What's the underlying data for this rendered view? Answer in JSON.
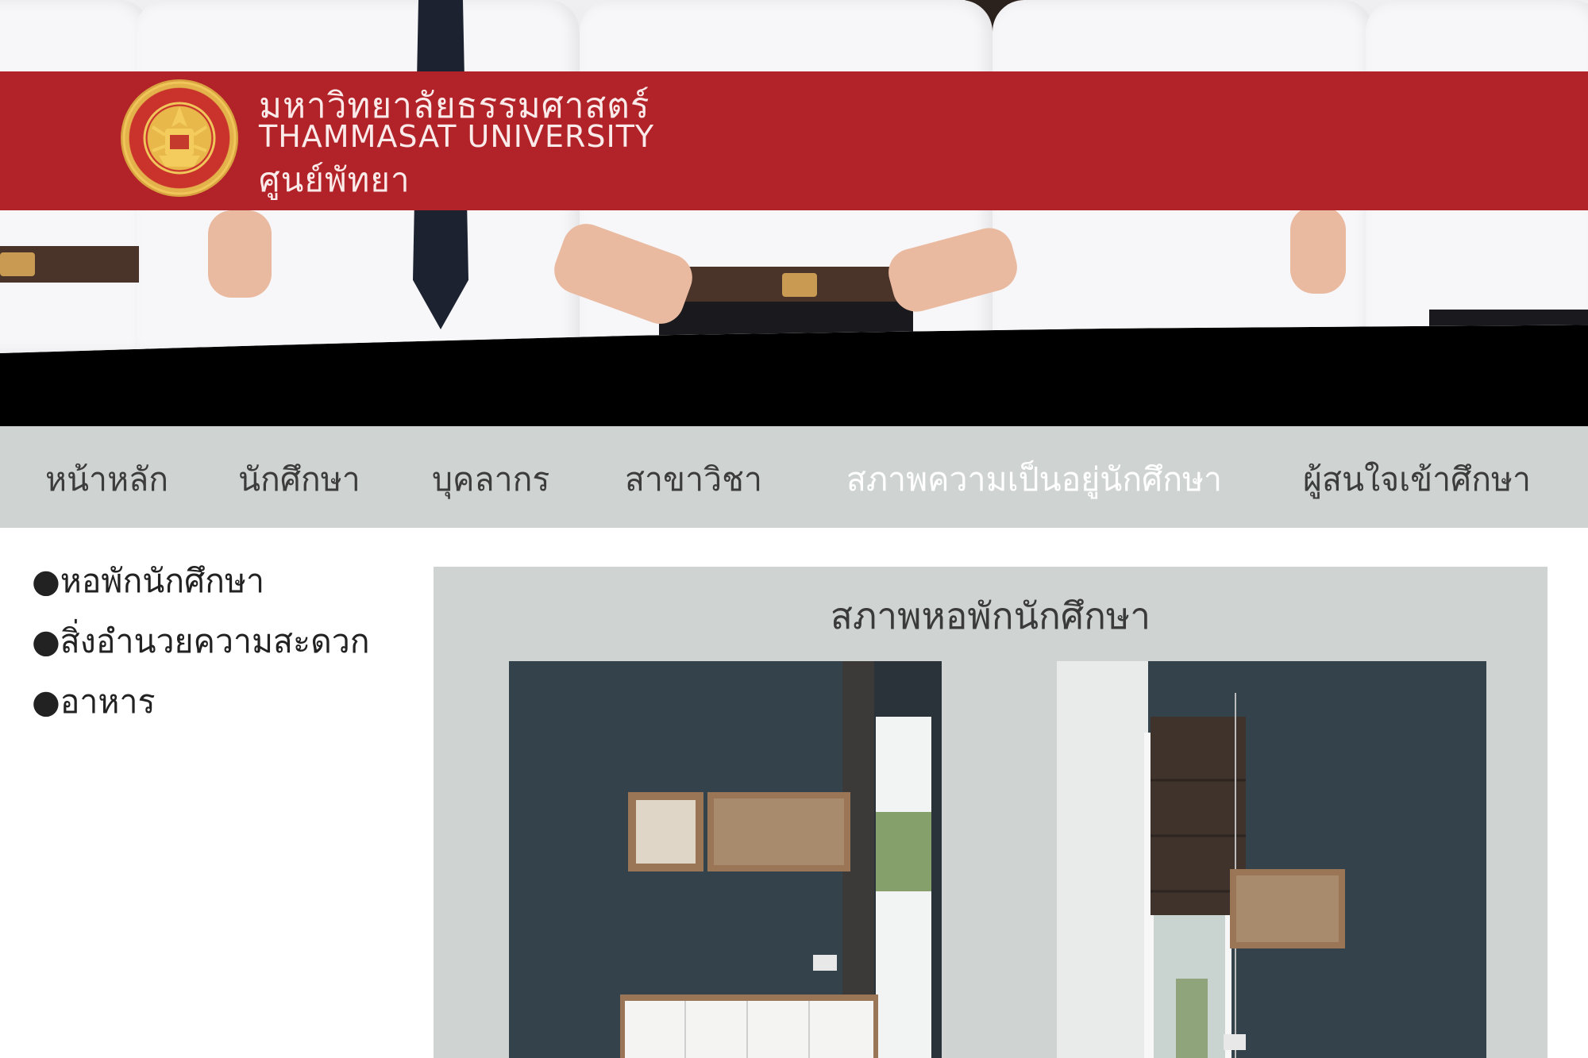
{
  "brand": {
    "name_th": "มหาวิทยาลัยธรรมศาสตร์",
    "name_en": "THAMMASAT UNIVERSITY",
    "center": "ศูนย์พัทยา",
    "bar_color": "#b12328",
    "logo_icon": "university-seal-icon"
  },
  "nav": {
    "items": [
      {
        "label": "หน้าหลัก"
      },
      {
        "label": "นักศึกษา"
      },
      {
        "label": "บุคลากร"
      },
      {
        "label": "สาขาวิชา"
      },
      {
        "label": "สภาพความเป็นอยู่นักศึกษา",
        "active": true
      },
      {
        "label": "ผู้สนใจเข้าศึกษา"
      }
    ]
  },
  "sidebar": {
    "items": [
      {
        "label": "●หอพักนักศึกษา"
      },
      {
        "label": "●สิ่งอำนวยความสะดวก"
      },
      {
        "label": "●อาหาร"
      }
    ]
  },
  "content": {
    "title": "สภาพหอพักนักศึกษา"
  }
}
